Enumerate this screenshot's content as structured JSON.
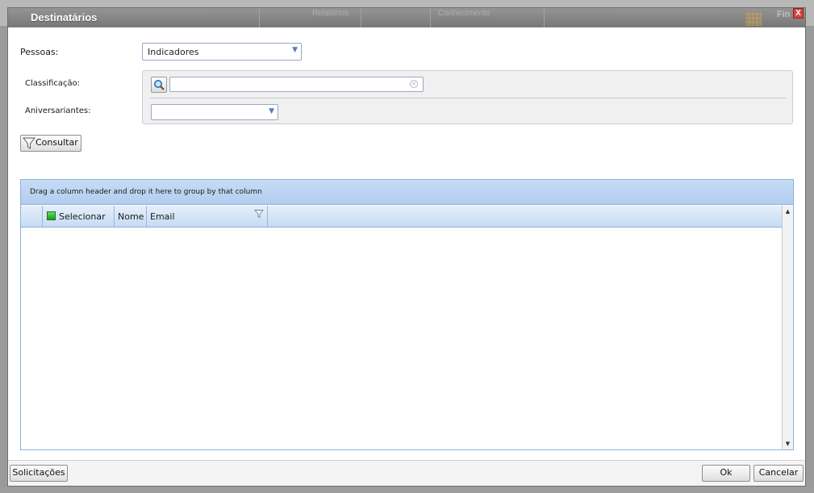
{
  "dialog": {
    "title": "Destinatários",
    "close_label": "X"
  },
  "background": {
    "ghost_labels": [
      "Relatórios",
      "Conhecimento"
    ],
    "ghost_right_text": "Fin"
  },
  "form": {
    "pessoas_label": "Pessoas:",
    "pessoas_value": "Indicadores",
    "classificacao_label": "Classificação:",
    "classificacao_value": "",
    "aniversariantes_label": "Aniversariantes:",
    "aniversariantes_value": "",
    "consultar_label": "Consultar"
  },
  "grid": {
    "group_hint": "Drag a column header and drop it here to group by that column",
    "columns": [
      "Selecionar",
      "Nome",
      "Email"
    ],
    "rows": []
  },
  "footer": {
    "solicitacoes_label": "Solicitações",
    "ok_label": "Ok",
    "cancelar_label": "Cancelar"
  },
  "colors": {
    "close_button": "#d9322a",
    "grid_header": "#c6dbf3",
    "select_indicator": "#1a9a1a"
  },
  "icons": {
    "search": "magnifier-icon",
    "consultar": "funnel-icon",
    "column_filter": "funnel-icon",
    "clear": "clear-x-icon"
  }
}
